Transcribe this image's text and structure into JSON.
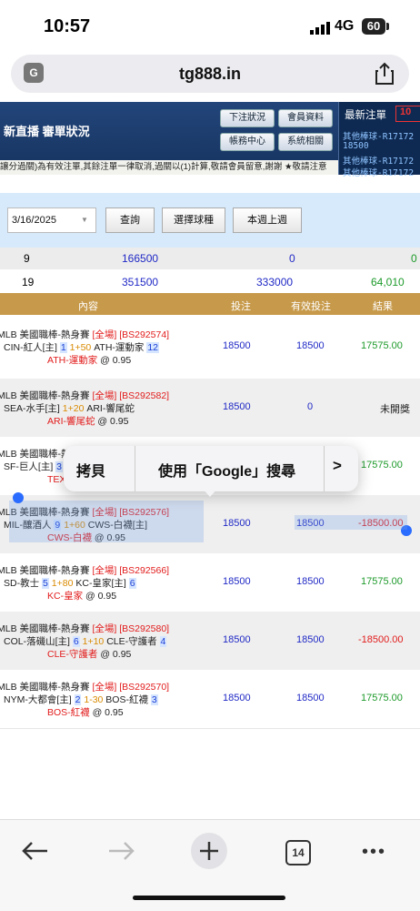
{
  "status": {
    "time": "10:57",
    "network": "4G",
    "battery": "60"
  },
  "browser": {
    "url": "tg888.in",
    "tab_count": "14"
  },
  "site": {
    "nav_text": "新直播  審單狀況",
    "buttons": [
      "下注狀況",
      "會員資料",
      "帳務中心",
      "系統相關"
    ],
    "ticker": "讓分過關)為有效注單,其餘注單一律取消,過關以(1)計算,敬請會員留意,謝謝 ★敬請注意",
    "latest_title": "最新注單",
    "latest_count": "10",
    "latest_items": [
      "其他棒球-R17172",
      "18500",
      "其他棒球-R17172",
      "其他棒球-R17172"
    ]
  },
  "filter": {
    "date": "3/16/2025",
    "query_button": "查詢",
    "sport_button": "選擇球種",
    "week_button": "本週上週"
  },
  "totals": [
    {
      "count": "9",
      "stake": "166500",
      "valid": "0",
      "result": "0"
    },
    {
      "count": "19",
      "stake": "351500",
      "valid": "333000",
      "result": "64,010"
    }
  ],
  "columns": {
    "content": "內容",
    "stake": "投注",
    "valid": "有效投注",
    "result": "結果"
  },
  "bets": [
    {
      "league": "MLB 美國職棒-熱身賽",
      "market": "[全場]",
      "code": "[BS292574]",
      "home": "CIN-紅人[主]",
      "hs": "1",
      "line": "1+50",
      "away": "ATH-運動家",
      "as": "12",
      "pick": "ATH-運動家",
      "odds": "@ 0.95",
      "stake": "18500",
      "valid": "18500",
      "result": "17575.00",
      "rstate": "win"
    },
    {
      "league": "MLB 美國職棒-熱身賽",
      "market": "[全場]",
      "code": "[BS292582]",
      "home": "SEA-水手[主]",
      "hs": "",
      "line": "1+20",
      "away": "ARI-響尾蛇",
      "as": "",
      "pick": "ARI-響尾蛇",
      "odds": "@ 0.95",
      "stake": "18500",
      "valid": "0",
      "result": "未開獎",
      "rstate": "pending"
    },
    {
      "league": "MLB 美國職棒-熱身",
      "market": "",
      "code": "",
      "home": "SF-巨人[主]",
      "hs": "3",
      "line": "",
      "away": "",
      "as": "",
      "pick": "TEX-遊",
      "odds": "",
      "stake": "",
      "valid": "",
      "result": "17575.00",
      "rstate": "win"
    },
    {
      "league": "MLB 美國職棒-熱身賽",
      "market": "[全場]",
      "code": "[BS292576]",
      "home": "MIL-釀酒人",
      "hs": "9",
      "line": "1+60",
      "away": "CWS-白襪[主]",
      "as": "",
      "pick": "CWS-白襪",
      "odds": "@ 0.95",
      "stake": "18500",
      "valid": "18500",
      "result": "-18500.00",
      "rstate": "lose"
    },
    {
      "league": "MLB 美國職棒-熱身賽",
      "market": "[全場]",
      "code": "[BS292566]",
      "home": "SD-教士",
      "hs": "5",
      "line": "1+80",
      "away": "KC-皇家[主]",
      "as": "6",
      "pick": "KC-皇家",
      "odds": "@ 0.95",
      "stake": "18500",
      "valid": "18500",
      "result": "17575.00",
      "rstate": "win"
    },
    {
      "league": "MLB 美國職棒-熱身賽",
      "market": "[全場]",
      "code": "[BS292580]",
      "home": "COL-落磯山[主]",
      "hs": "6",
      "line": "1+10",
      "away": "CLE-守護者",
      "as": "4",
      "pick": "CLE-守護者",
      "odds": "@ 0.95",
      "stake": "18500",
      "valid": "18500",
      "result": "-18500.00",
      "rstate": "lose"
    },
    {
      "league": "MLB 美國職棒-熱身賽",
      "market": "[全場]",
      "code": "[BS292570]",
      "home": "NYM-大都會[主]",
      "hs": "2",
      "line": "1-30",
      "away": "BOS-紅襪",
      "as": "3",
      "pick": "BOS-紅襪",
      "odds": "@ 0.95",
      "stake": "18500",
      "valid": "18500",
      "result": "17575.00",
      "rstate": "win"
    }
  ],
  "context_menu": {
    "copy": "拷貝",
    "search": "使用「Google」搜尋",
    "more": ">"
  },
  "colors": {
    "header_blue": "#1b3c6e",
    "col_header": "#c79a4b",
    "win": "#1d9a2a",
    "lose": "#e21c1c",
    "link_blue": "#2029c5"
  }
}
